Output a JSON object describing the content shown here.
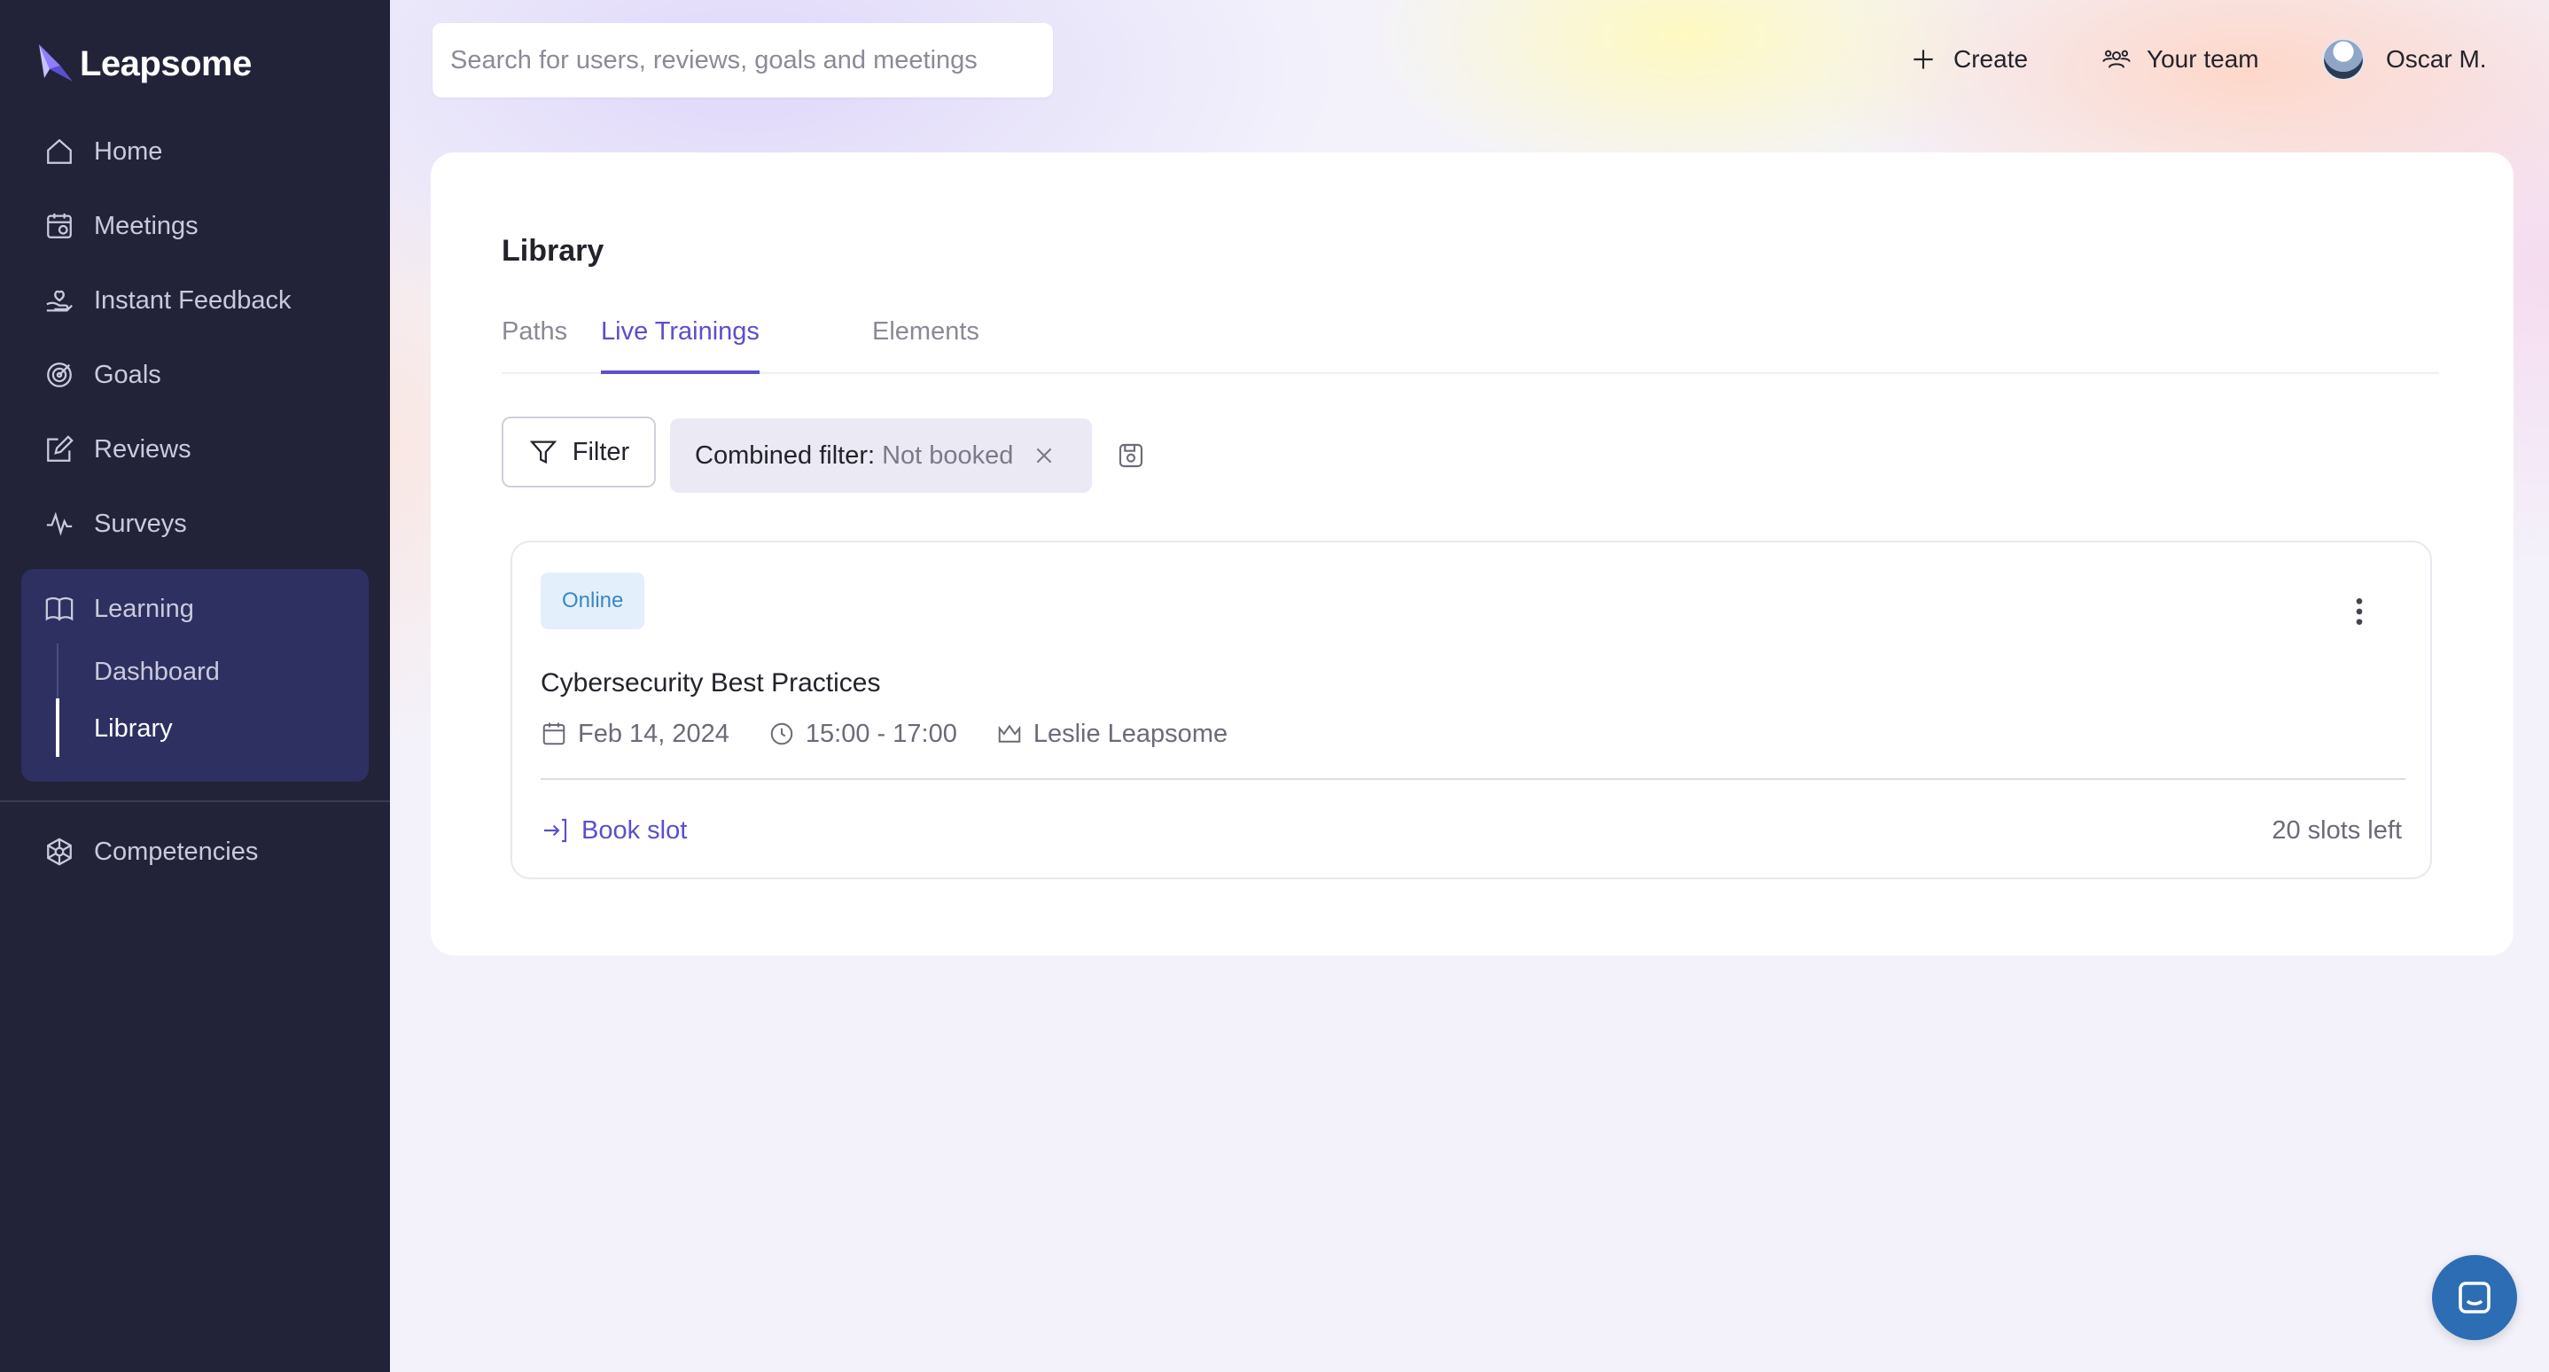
{
  "brand": {
    "name": "Leapsome"
  },
  "sidebar": {
    "items": [
      {
        "label": "Home",
        "icon": "home-icon"
      },
      {
        "label": "Meetings",
        "icon": "meetings-icon"
      },
      {
        "label": "Instant Feedback",
        "icon": "feedback-icon"
      },
      {
        "label": "Goals",
        "icon": "goals-icon"
      },
      {
        "label": "Reviews",
        "icon": "reviews-icon"
      },
      {
        "label": "Surveys",
        "icon": "surveys-icon"
      }
    ],
    "learning": {
      "label": "Learning",
      "icon": "book-icon",
      "sub_items": [
        {
          "label": "Dashboard"
        },
        {
          "label": "Library",
          "active": true
        }
      ]
    },
    "bottom_items": [
      {
        "label": "Competencies",
        "icon": "competencies-icon"
      }
    ]
  },
  "topbar": {
    "search_placeholder": "Search for users, reviews, goals and meetings",
    "create_label": "Create",
    "team_label": "Your team",
    "user_name": "Oscar M."
  },
  "library": {
    "title": "Library",
    "tabs": [
      {
        "label": "Paths",
        "active": false
      },
      {
        "label": "Live Trainings",
        "active": true
      },
      {
        "label": "Elements",
        "active": false
      }
    ],
    "filter_label": "Filter",
    "chip": {
      "label": "Combined filter:",
      "value": "Not booked"
    }
  },
  "training": {
    "badge": "Online",
    "title": "Cybersecurity Best Practices",
    "date": "Feb 14, 2024",
    "time": "15:00 - 17:00",
    "host": "Leslie Leapsome",
    "book_label": "Book slot",
    "slots_left": "20 slots left"
  },
  "colors": {
    "sidebar_bg": "#222339",
    "sidebar_active": "#2e3062",
    "accent": "#5a4fcf",
    "badge_bg": "#e3f0fb",
    "chat": "#2d6db4"
  }
}
